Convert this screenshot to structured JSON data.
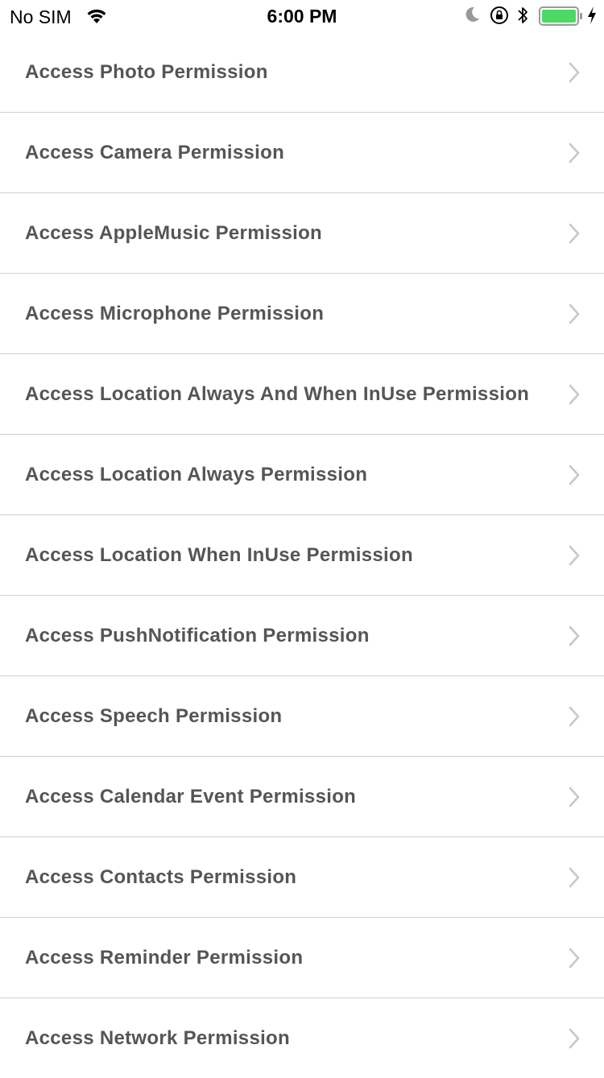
{
  "status_bar": {
    "carrier": "No SIM",
    "time": "6:00 PM",
    "icons": [
      "wifi-icon",
      "moon-icon",
      "orientation-lock-icon",
      "bluetooth-icon",
      "battery-icon",
      "charging-bolt-icon"
    ],
    "battery_color": "#4cd964"
  },
  "list": {
    "items": [
      {
        "label": "Access Photo Permission"
      },
      {
        "label": "Access Camera Permission"
      },
      {
        "label": "Access AppleMusic Permission"
      },
      {
        "label": "Access Microphone Permission"
      },
      {
        "label": "Access Location Always And When InUse Permission"
      },
      {
        "label": "Access Location Always Permission"
      },
      {
        "label": "Access Location When InUse Permission"
      },
      {
        "label": "Access PushNotification Permission"
      },
      {
        "label": "Access Speech Permission"
      },
      {
        "label": "Access Calendar Event Permission"
      },
      {
        "label": "Access Contacts Permission"
      },
      {
        "label": "Access Reminder Permission"
      },
      {
        "label": "Access Network Permission"
      }
    ],
    "accessory_icon": "chevron-right-icon",
    "text_color": "#555555",
    "separator_color": "#d0d0d4"
  }
}
